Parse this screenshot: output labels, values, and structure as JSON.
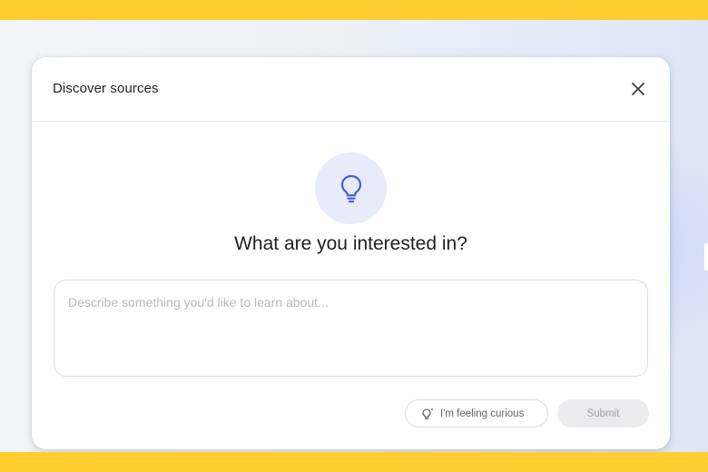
{
  "dialog": {
    "title": "Discover sources",
    "close_icon": "close-icon",
    "hero_icon": "lightbulb-icon",
    "headline": "What are you interested in?",
    "input_placeholder": "Describe something you'd like to learn about...",
    "input_value": "",
    "curious_button": {
      "icon": "lightbulb-sparkle-icon",
      "label": "I'm feeling curious"
    },
    "submit_button": {
      "label": "Submit",
      "enabled": false
    }
  },
  "colors": {
    "frame_yellow": "#fecd2f",
    "accent_indigo": "#4a5bd4",
    "icon_circle": "#e8ebfa",
    "disabled_button": "#ececee"
  }
}
